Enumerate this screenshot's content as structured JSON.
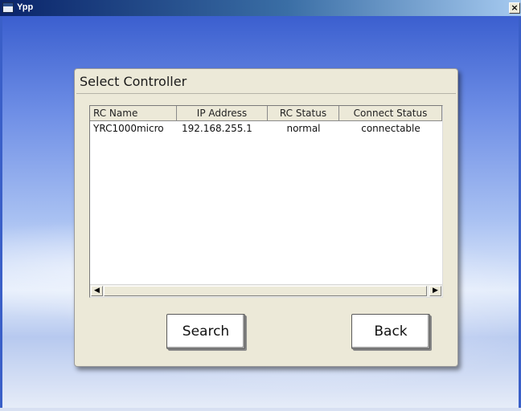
{
  "window": {
    "title": "Ypp",
    "close_label": "×"
  },
  "dialog": {
    "title": "Select Controller"
  },
  "table": {
    "columns": [
      "RC Name",
      "IP Address",
      "RC Status",
      "Connect Status"
    ],
    "rows": [
      [
        "YRC1000micro",
        "192.168.255.1",
        "normal",
        "connectable"
      ]
    ]
  },
  "scrollbar": {
    "left_arrow": "◀",
    "right_arrow": "▶"
  },
  "buttons": {
    "search_label": "Search",
    "back_label": "Back"
  },
  "icons": {
    "app": "app-window-icon",
    "close": "close-icon"
  },
  "colors": {
    "titlebar_start": "#0a246a",
    "titlebar_end": "#a6caf0",
    "dialog_bg": "#ece9d8",
    "desktop_top": "#3b5fcf"
  }
}
